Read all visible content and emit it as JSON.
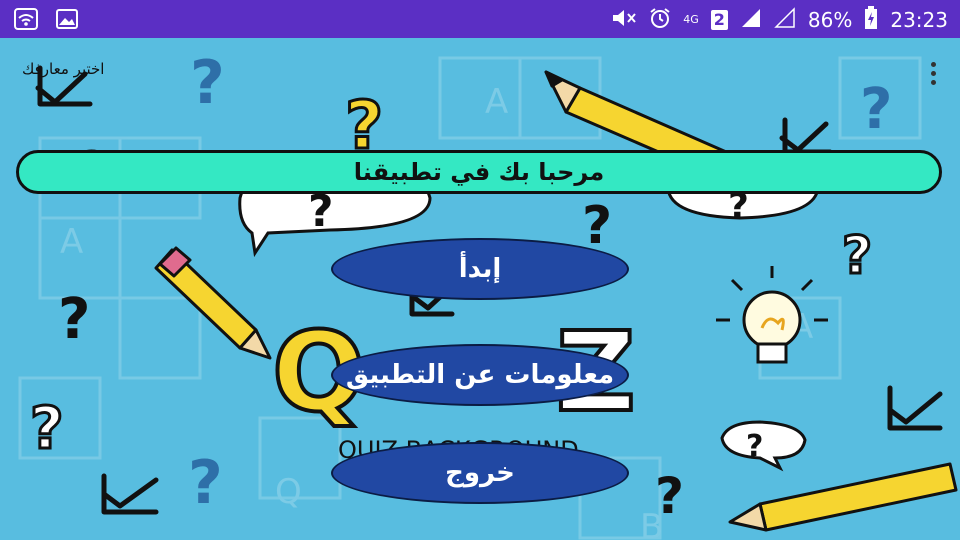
{
  "status_bar": {
    "battery_percent": "86%",
    "time": "23:23",
    "network_type": "4G",
    "sim_slot": "2",
    "icons": [
      "wifi-icon",
      "gallery-icon",
      "mute-icon",
      "alarm-icon",
      "signal-icon",
      "signal-empty-icon",
      "battery-charging-icon"
    ],
    "background": "#5b2fc4"
  },
  "app": {
    "title": "اختبر معارفك",
    "background": "#58bde0"
  },
  "banner": {
    "text": "مرحبا بك في تطبيقنا",
    "color": "#34e8c3"
  },
  "buttons": {
    "start": "إبدأ",
    "about": "معلومات عن التطبيق",
    "exit": "خروج",
    "color": "#2148a3"
  },
  "background_art": {
    "quiz_text": "QUIZ BACKGROUND",
    "letters": [
      "A",
      "A",
      "Q",
      "B",
      "A"
    ]
  }
}
